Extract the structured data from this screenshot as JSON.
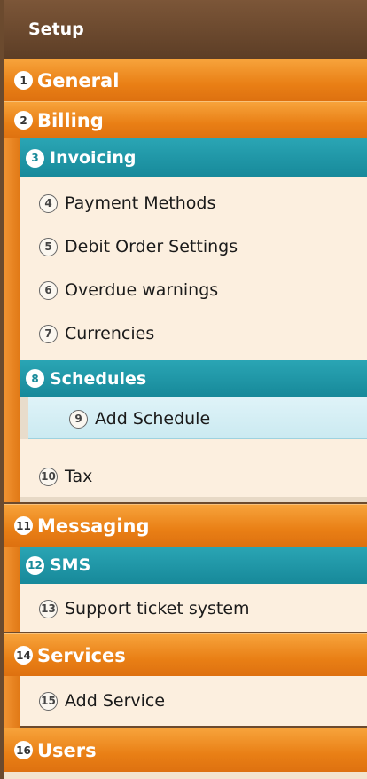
{
  "header": {
    "title": "Setup"
  },
  "menu": {
    "general": {
      "num": "1",
      "label": "General"
    },
    "billing": {
      "num": "2",
      "label": "Billing"
    },
    "invoicing": {
      "num": "3",
      "label": "Invoicing"
    },
    "payment_methods": {
      "num": "4",
      "label": "Payment Methods"
    },
    "debit_order": {
      "num": "5",
      "label": "Debit Order Settings"
    },
    "overdue": {
      "num": "6",
      "label": "Overdue warnings"
    },
    "currencies": {
      "num": "7",
      "label": "Currencies"
    },
    "schedules": {
      "num": "8",
      "label": "Schedules"
    },
    "add_schedule": {
      "num": "9",
      "label": "Add Schedule"
    },
    "tax": {
      "num": "10",
      "label": "Tax"
    },
    "messaging": {
      "num": "11",
      "label": "Messaging"
    },
    "sms": {
      "num": "12",
      "label": "SMS"
    },
    "support": {
      "num": "13",
      "label": "Support ticket system"
    },
    "services": {
      "num": "14",
      "label": "Services"
    },
    "add_service": {
      "num": "15",
      "label": "Add Service"
    },
    "users": {
      "num": "16",
      "label": "Users"
    }
  },
  "colors": {
    "orange": "#e97f15",
    "teal": "#17899a",
    "cream": "#fcefdf",
    "brown": "#6b4a2e"
  }
}
